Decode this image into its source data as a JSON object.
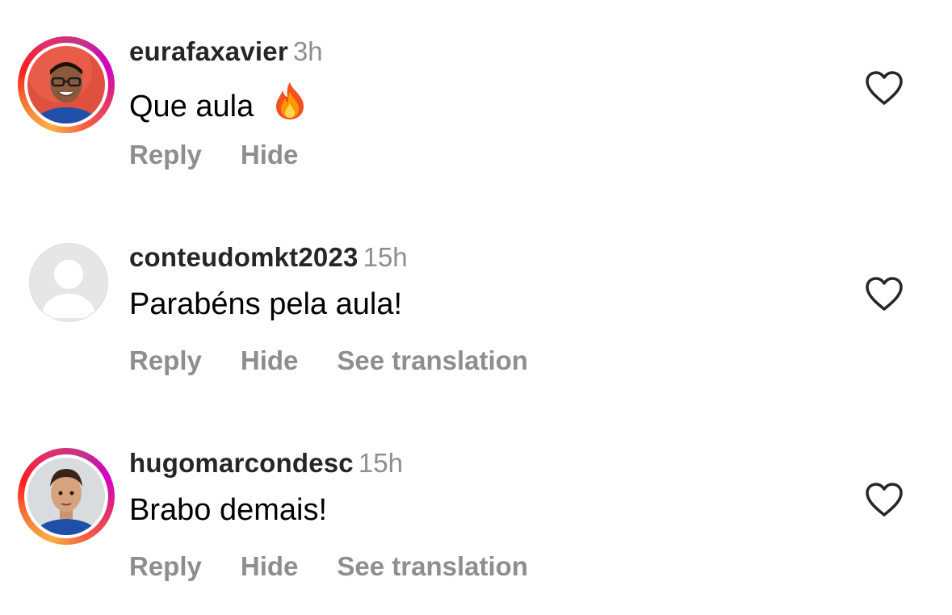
{
  "comments": [
    {
      "username": "eurafaxavier",
      "time": "3h",
      "text": "Que aula",
      "emoji": "fire-emoji",
      "has_story_ring": true,
      "actions": [
        "Reply",
        "Hide"
      ]
    },
    {
      "username": "conteudomkt2023",
      "time": "15h",
      "text": "Parabéns pela aula!",
      "has_story_ring": false,
      "actions": [
        "Reply",
        "Hide",
        "See translation"
      ]
    },
    {
      "username": "hugomarcondesc",
      "time": "15h",
      "text": "Brabo demais!",
      "has_story_ring": true,
      "actions": [
        "Reply",
        "Hide",
        "See translation"
      ]
    }
  ],
  "icons": {
    "like": "heart-outline-icon",
    "default_avatar": "default-avatar-icon"
  },
  "colors": {
    "username": "#262626",
    "secondary_text": "#8e8e8e",
    "body_text": "#000000",
    "story_ring_start": "#fcaf45",
    "story_ring_end": "#d300c5"
  }
}
